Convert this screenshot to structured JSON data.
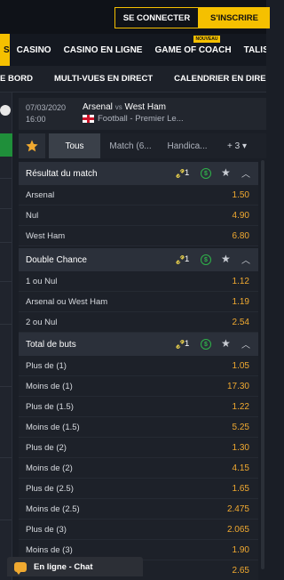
{
  "auth": {
    "login_label": "SE CONNECTER",
    "signup_label": "S'INSCRIRE"
  },
  "main_nav": {
    "first_label": "S",
    "items": [
      "CASINO",
      "CASINO EN LIGNE",
      "GAME OF COACH",
      "TALISMAN"
    ],
    "new_badge": "NOUVEAU"
  },
  "sub_nav": {
    "items": [
      "E BORD",
      "MULTI-VUES EN DIRECT",
      "CALENDRIER EN DIRECT"
    ]
  },
  "match": {
    "date": "07/03/2020",
    "time": "16:00",
    "home": "Arsenal",
    "vs": "vs",
    "away": "West Ham",
    "competition": "Football - Premier Le..."
  },
  "tabs": [
    "Tous",
    "Match (6...",
    "Handica...",
    "+ 3 ▾"
  ],
  "markets": [
    {
      "title": "Résultat du match",
      "link_count": "1",
      "rows": [
        {
          "label": "Arsenal",
          "odd": "1.50"
        },
        {
          "label": "Nul",
          "odd": "4.90"
        },
        {
          "label": "West Ham",
          "odd": "6.80"
        }
      ]
    },
    {
      "title": "Double Chance",
      "link_count": "1",
      "rows": [
        {
          "label": "1 ou Nul",
          "odd": "1.12"
        },
        {
          "label": "Arsenal ou West Ham",
          "odd": "1.19"
        },
        {
          "label": "2 ou Nul",
          "odd": "2.54"
        }
      ]
    },
    {
      "title": "Total de buts",
      "link_count": "1",
      "rows": [
        {
          "label": "Plus de (1)",
          "odd": "1.05"
        },
        {
          "label": "Moins de (1)",
          "odd": "17.30"
        },
        {
          "label": "Plus de (1.5)",
          "odd": "1.22"
        },
        {
          "label": "Moins de (1.5)",
          "odd": "5.25"
        },
        {
          "label": "Plus de (2)",
          "odd": "1.30"
        },
        {
          "label": "Moins de (2)",
          "odd": "4.15"
        },
        {
          "label": "Plus de (2.5)",
          "odd": "1.65"
        },
        {
          "label": "Moins de (2.5)",
          "odd": "2.475"
        },
        {
          "label": "Plus de (3)",
          "odd": "2.065"
        },
        {
          "label": "Moins de (3)",
          "odd": "1.90"
        },
        {
          "label": "",
          "odd": "2.65"
        }
      ]
    }
  ],
  "chat": {
    "label": "En ligne - Chat"
  },
  "icons": {
    "link": "link-icon",
    "cashout": "dollar-icon",
    "favorite": "star-icon",
    "collapse": "chevron-up-icon"
  },
  "colors": {
    "accent": "#f5c000",
    "odds": "#f0a930",
    "cashout": "#2fb34a"
  }
}
